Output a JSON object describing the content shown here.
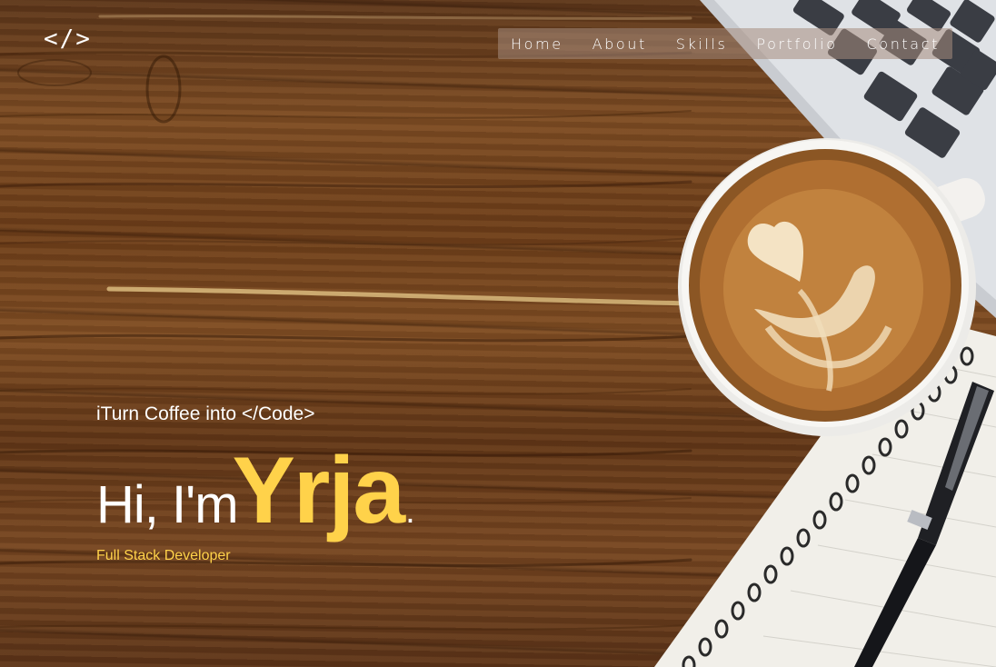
{
  "logo": {
    "text": "</>"
  },
  "nav": {
    "items": [
      {
        "label": "Home"
      },
      {
        "label": "About"
      },
      {
        "label": "Skills"
      },
      {
        "label": "Portfolio"
      },
      {
        "label": "Contact"
      }
    ]
  },
  "hero": {
    "tagline": "iTurn Coffee into </Code>",
    "greeting": "Hi, I'm",
    "name": "Yrja",
    "period": ".",
    "role": "Full Stack Developer"
  },
  "colors": {
    "accent": "#ffd24a",
    "text": "#ffffff",
    "nav_background": "#a58c7d"
  }
}
